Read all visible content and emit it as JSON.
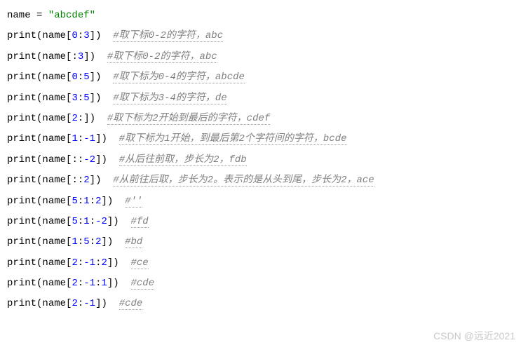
{
  "code": {
    "var_name": "name",
    "assign_op": " = ",
    "string_value": "\"abcdef\"",
    "fn_name": "print",
    "lines": [
      {
        "slice_parts": [
          "0",
          ":",
          "3"
        ],
        "comment": "#取下标0-2的字符，abc"
      },
      {
        "slice_parts": [
          ":",
          "3"
        ],
        "comment": "#取下标0-2的字符，abc"
      },
      {
        "slice_parts": [
          "0",
          ":",
          "5"
        ],
        "comment": "#取下标为0-4的字符，abcde"
      },
      {
        "slice_parts": [
          "3",
          ":",
          "5"
        ],
        "comment": "#取下标为3-4的字符，de"
      },
      {
        "slice_parts": [
          "2",
          ":"
        ],
        "comment": "#取下标为2开始到最后的字符，cdef"
      },
      {
        "slice_parts": [
          "1",
          ":",
          "-1"
        ],
        "comment": "#取下标为1开始，到最后第2个字符间的字符，bcde"
      },
      {
        "slice_parts": [
          ":",
          ":",
          "-2"
        ],
        "comment": "#从后往前取，步长为2，fdb"
      },
      {
        "slice_parts": [
          ":",
          ":",
          "2"
        ],
        "comment": "#从前往后取，步长为2。表示的是从头到尾，步长为2，ace"
      },
      {
        "slice_parts": [
          "5",
          ":",
          "1",
          ":",
          "2"
        ],
        "comment": "#''"
      },
      {
        "slice_parts": [
          "5",
          ":",
          "1",
          ":",
          "-2"
        ],
        "comment": "#fd"
      },
      {
        "slice_parts": [
          "1",
          ":",
          "5",
          ":",
          "2"
        ],
        "comment": "#bd"
      },
      {
        "slice_parts": [
          "2",
          ":",
          "-1",
          ":",
          "2"
        ],
        "comment": "#ce"
      },
      {
        "slice_parts": [
          "2",
          ":",
          "-1",
          ":",
          "1"
        ],
        "comment": "#cde"
      },
      {
        "slice_parts": [
          "2",
          ":",
          "-1"
        ],
        "comment": "#cde"
      }
    ]
  },
  "watermark": "CSDN @远近2021"
}
